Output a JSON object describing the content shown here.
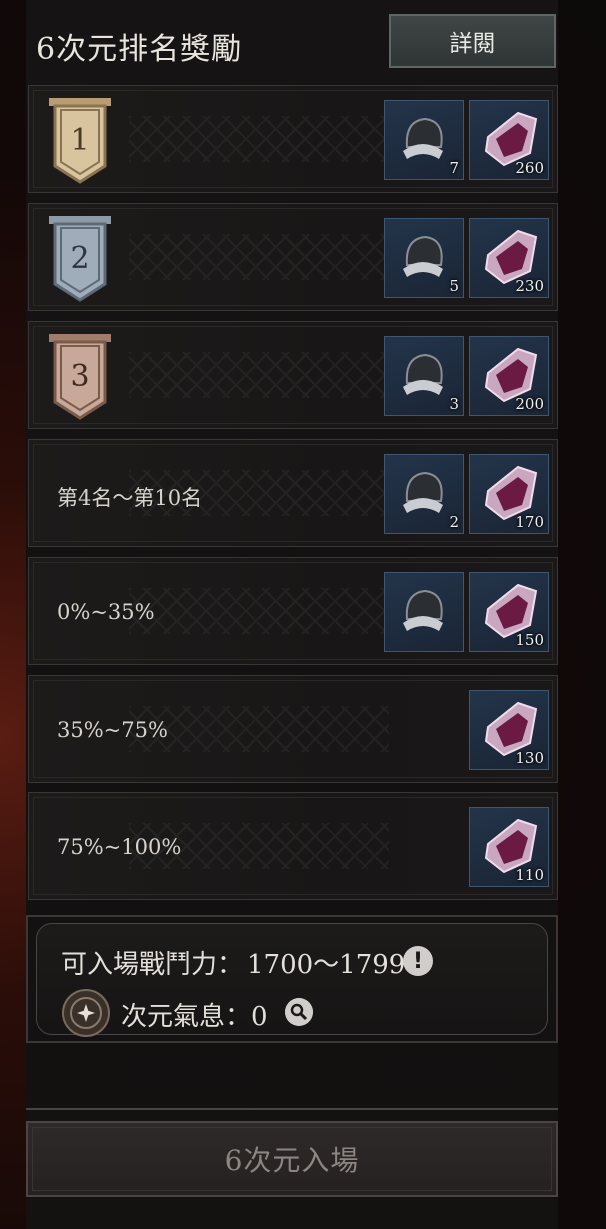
{
  "header": {
    "title": "6次元排名獎勵",
    "detail_label": "詳閱"
  },
  "rows": [
    {
      "label": "",
      "rank_badge": "1",
      "badge_color": "#b99d72",
      "helm_qty": "7",
      "gem_qty": "260"
    },
    {
      "label": "",
      "rank_badge": "2",
      "badge_color": "#8e9aa6",
      "helm_qty": "5",
      "gem_qty": "230"
    },
    {
      "label": "",
      "rank_badge": "3",
      "badge_color": "#a07c6a",
      "helm_qty": "3",
      "gem_qty": "200"
    },
    {
      "label": "第4名～第10名",
      "rank_badge": "",
      "helm_qty": "2",
      "gem_qty": "170"
    },
    {
      "label": "0%~35%",
      "rank_badge": "",
      "helm_qty": "",
      "gem_qty": "150"
    },
    {
      "label": "35%~75%",
      "rank_badge": "",
      "helm_qty": "",
      "gem_qty": "130"
    },
    {
      "label": "75%~100%",
      "rank_badge": "",
      "helm_qty": "",
      "gem_qty": "110"
    }
  ],
  "info": {
    "power_label": "可入場戰鬥力：",
    "power_value": "1700～1799",
    "aura_label": "次元氣息：",
    "aura_value": "0"
  },
  "enter_label": "6次元入場",
  "icons": {
    "helm": "helmet-icon",
    "gem": "crystal-icon",
    "warn": "exclamation-icon",
    "zoom": "magnifier-icon"
  }
}
